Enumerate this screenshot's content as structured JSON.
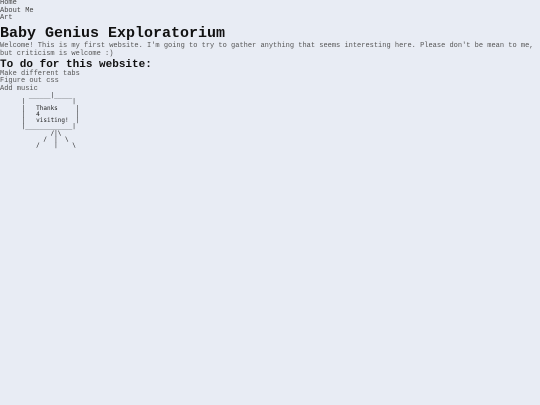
{
  "nav": {
    "items": [
      {
        "label": "Home"
      },
      {
        "label": "About Me"
      },
      {
        "label": "Art"
      }
    ]
  },
  "header": {
    "title": "Baby Genius Exploratorium"
  },
  "intro": {
    "text": "Welcome! This is my first website. I'm going to try to gather anything that seems interesting here. Please don't be mean to me, but criticism is welcome :)"
  },
  "todo": {
    "heading": "To do for this website:",
    "items": [
      {
        "label": "Make different tabs"
      },
      {
        "label": "Figure out css"
      },
      {
        "label": "Add music"
      }
    ]
  },
  "sign": {
    "art": "        ______|_____\n      |             |\n      |   Thanks     |\n      |   4          |\n      |   visiting!  |\n      |_____________|\n              /|\\\n            /  |  \\\n          /    |    \\"
  }
}
